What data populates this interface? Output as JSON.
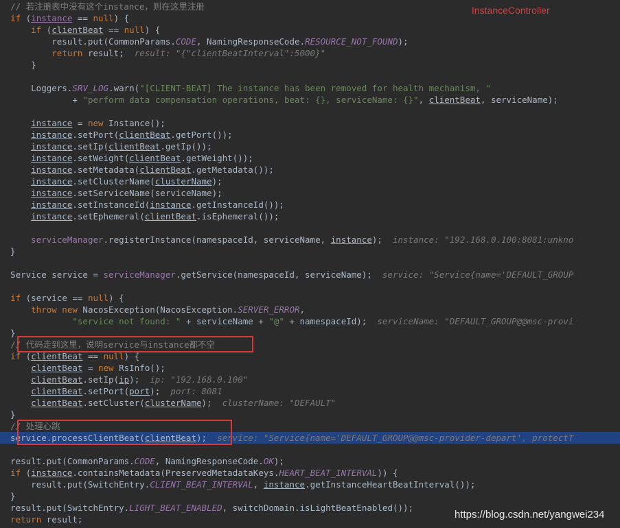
{
  "side_label": "InstanceController",
  "watermark": "https://blog.csdn.net/yangwei234",
  "colors": {
    "background": "#2b2b2b",
    "keyword": "#cc7832",
    "string": "#6a8759",
    "comment": "#808080",
    "field": "#9876aa",
    "highlight_line": "#214283",
    "annotation_red": "#d73a3a"
  },
  "code": {
    "c1": "// 若注册表中没有这个instance，则在这里注册",
    "hint_client_beat_interval": "result: \"{\"clientBeatInterval\":5000}\"",
    "log_str1": "\"[CLIENT-BEAT] The instance has been removed for health mechanism, \"",
    "log_str2": "\"perform data compensation operations, beat: {}, serviceName: {}\"",
    "hint_register": "instance: \"192.168.0.100:8081:unkno",
    "hint_get_service": "service: \"Service{name='DEFAULT_GROUP",
    "exc_str": "\"service not found: \"",
    "at_str": "\"@\"",
    "hint_service_name": "serviceName: \"DEFAULT_GROUP@@msc-provi",
    "c2": "// 代码走到这里，说明service与instance都不空",
    "hint_ip": "ip: \"192.168.0.100\"",
    "hint_port": "port: 8081",
    "hint_cluster": "clusterName: \"DEFAULT\"",
    "c3": "// 处理心跳",
    "hint_process": "service: \"Service{name='DEFAULT_GROUP@@msc-provider-depart', protectT"
  }
}
